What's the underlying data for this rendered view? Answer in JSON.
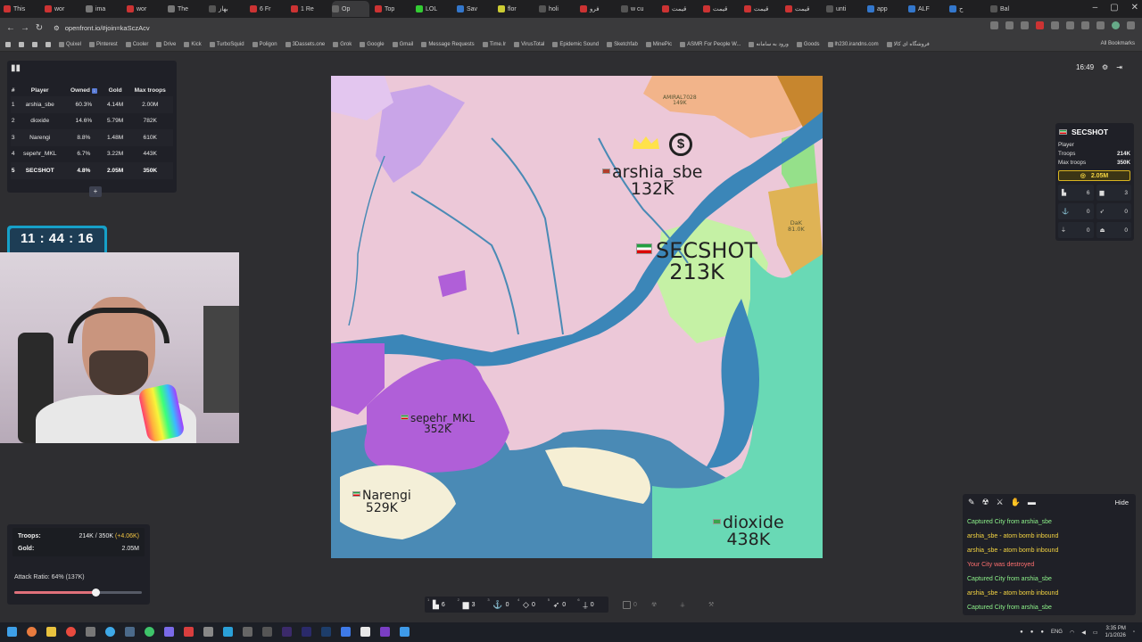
{
  "browser": {
    "tabs": [
      "This",
      "wor",
      "ima",
      "wor",
      "The",
      "بهاز",
      "6 Fr",
      "1 Re",
      "Op",
      "Top",
      "LOL",
      "Sav",
      "flor",
      "holi",
      "فرو",
      "w cu",
      "قیمت",
      "قیمت",
      "قیمت",
      "قیمت",
      "unti",
      "app",
      "ALF",
      "ح",
      "Bal"
    ],
    "active_tab_index": 8,
    "url": "openfront.io/#join=kaSczAcv",
    "bookmarks": [
      "Quixel",
      "Pinterest",
      "Cooler",
      "Drive",
      "Kick",
      "TurboSquid",
      "Poligon",
      "3Dassets.one",
      "Grok",
      "Google",
      "Gmail",
      "Message Requests",
      "Time.Ir",
      "VirusTotal",
      "Epidemic Sound",
      "Sketchfab",
      "MinePic",
      "ASMR For People W...",
      "ورود به سامانه",
      "Goods",
      "lh230.irandns.com",
      "فروشگاه ای کالا"
    ],
    "all_bookmarks": "All Bookmarks"
  },
  "leaderboard": {
    "headers": [
      "#",
      "Player",
      "Owned",
      "Gold",
      "Max troops"
    ],
    "rows": [
      {
        "rank": "1",
        "player": "arshia_sbe",
        "owned": "60.3%",
        "gold": "4.14M",
        "max_troops": "2.00M"
      },
      {
        "rank": "2",
        "player": "dioxide",
        "owned": "14.6%",
        "gold": "5.79M",
        "max_troops": "782K"
      },
      {
        "rank": "3",
        "player": "Narengi",
        "owned": "8.8%",
        "gold": "1.48M",
        "max_troops": "610K"
      },
      {
        "rank": "4",
        "player": "sepehr_MKL",
        "owned": "6.7%",
        "gold": "3.22M",
        "max_troops": "443K"
      },
      {
        "rank": "5",
        "player": "SECSHOT",
        "owned": "4.8%",
        "gold": "2.05M",
        "max_troops": "350K"
      }
    ],
    "add_label": "+"
  },
  "timer": "11 : 44 : 16",
  "stats": {
    "troops_label": "Troops:",
    "troops_value": "214K / 350K",
    "troops_delta": "(+4.06K)",
    "gold_label": "Gold:",
    "gold_value": "2.05M",
    "attack_ratio": "Attack Ratio: 64% (137K)",
    "attack_ratio_fraction": 0.64
  },
  "map": {
    "labels": {
      "arshia": {
        "name": "arshia_sbe",
        "troops": "132K"
      },
      "secshot": {
        "name": "SECSHOT",
        "troops": "213K"
      },
      "sepehr": {
        "name": "sepehr_MKL",
        "troops": "352K"
      },
      "narengi": {
        "name": "Narengi",
        "troops": "529K"
      },
      "dioxide": {
        "name": "dioxide",
        "troops": "438K"
      },
      "amiral": {
        "name": "AMIRAL7028",
        "troops": "149K"
      },
      "dk": {
        "name": "DaK",
        "troops": "81.0K"
      }
    },
    "coin_symbol": "$"
  },
  "top_right": {
    "time": "16:49"
  },
  "player_panel": {
    "name": "SECSHOT",
    "type": "Player",
    "troops_label": "Troops",
    "troops": "214K",
    "max_label": "Max troops",
    "max_troops": "350K",
    "gold": "2.05M",
    "cells": [
      "6",
      "3",
      "0",
      "0",
      "0",
      "0"
    ]
  },
  "events": {
    "hide_label": "Hide",
    "items": [
      {
        "text": "Captured City from arshia_sbe",
        "color": "green"
      },
      {
        "text": "arshia_sbe - atom bomb inbound",
        "color": "yellow"
      },
      {
        "text": "arshia_sbe - atom bomb inbound",
        "color": "yellow"
      },
      {
        "text": "Your City was destroyed",
        "color": "red"
      },
      {
        "text": "Captured City from arshia_sbe",
        "color": "green"
      },
      {
        "text": "arshia_sbe - atom bomb inbound",
        "color": "yellow"
      },
      {
        "text": "Captured City from arshia_sbe",
        "color": "green"
      }
    ]
  },
  "build_bar": [
    {
      "key": "1",
      "count": "6"
    },
    {
      "key": "2",
      "count": "3"
    },
    {
      "key": "3",
      "count": "0"
    },
    {
      "key": "4",
      "count": "0"
    },
    {
      "key": "5",
      "count": "0"
    },
    {
      "key": "6",
      "count": "0"
    }
  ],
  "build_bar_disabled": [
    {
      "count": "0"
    }
  ],
  "taskbar": {
    "lang": "ENG",
    "time": "3:35 PM",
    "date": "1/1/2026"
  }
}
